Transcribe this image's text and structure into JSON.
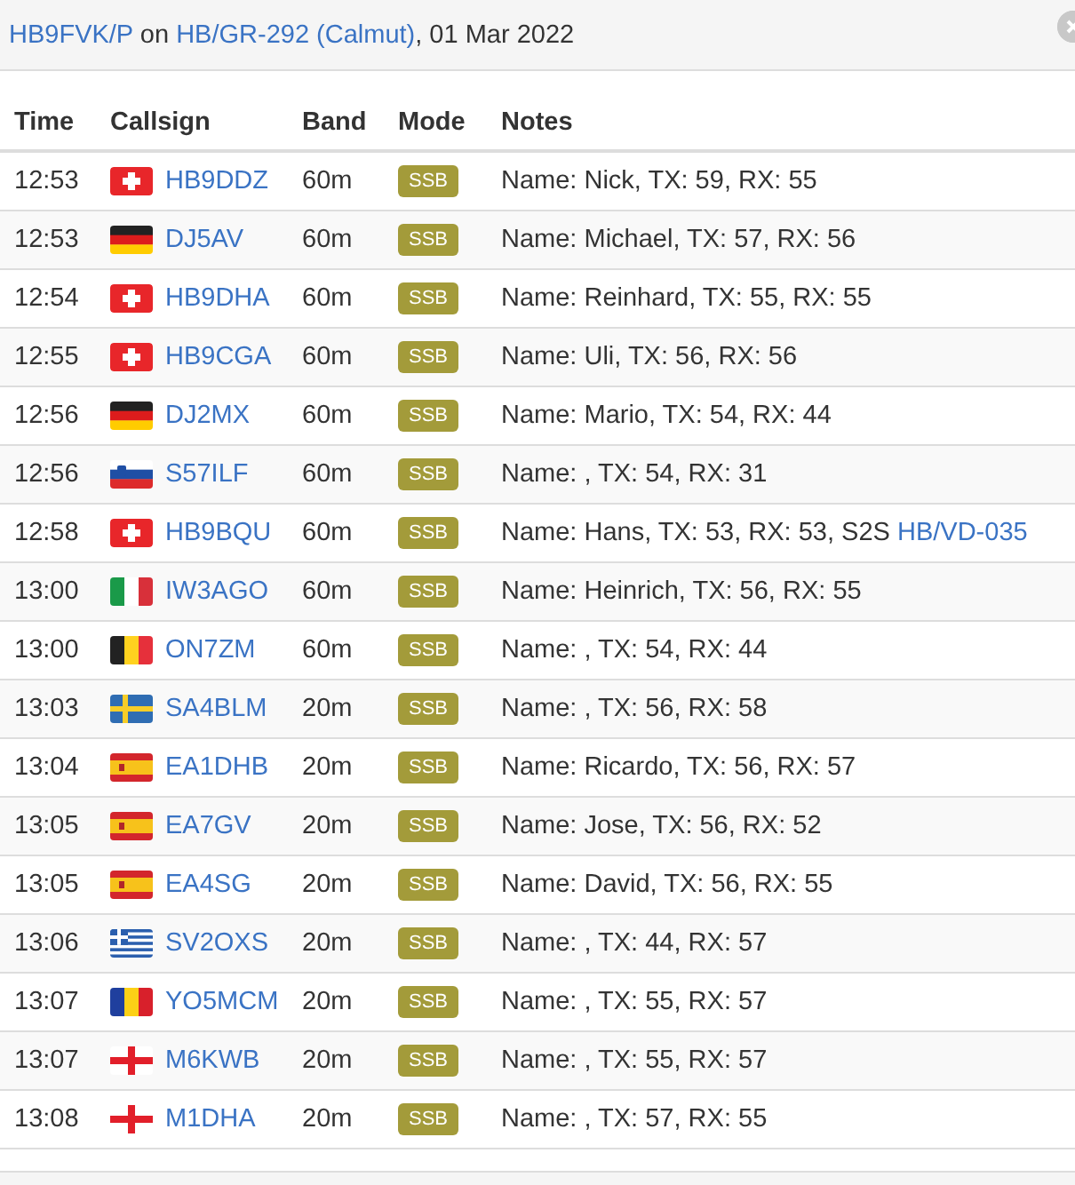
{
  "header": {
    "activator": "HB9FVK/P",
    "on": "on",
    "summit": "HB/GR-292 (Calmut)",
    "date": ", 01 Mar 2022"
  },
  "table": {
    "columns": [
      "Time",
      "Callsign",
      "Band",
      "Mode",
      "Notes"
    ],
    "rows": [
      {
        "time": "12:53",
        "flag": {
          "kind": "ch"
        },
        "callsign": "HB9DDZ",
        "band": "60m",
        "mode": "SSB",
        "notes": "Name: Nick, TX: 59, RX: 55"
      },
      {
        "time": "12:53",
        "flag": {
          "kind": "de"
        },
        "callsign": "DJ5AV",
        "band": "60m",
        "mode": "SSB",
        "notes": "Name: Michael, TX: 57, RX: 56"
      },
      {
        "time": "12:54",
        "flag": {
          "kind": "ch"
        },
        "callsign": "HB9DHA",
        "band": "60m",
        "mode": "SSB",
        "notes": "Name: Reinhard, TX: 55, RX: 55"
      },
      {
        "time": "12:55",
        "flag": {
          "kind": "ch"
        },
        "callsign": "HB9CGA",
        "band": "60m",
        "mode": "SSB",
        "notes": "Name: Uli, TX: 56, RX: 56"
      },
      {
        "time": "12:56",
        "flag": {
          "kind": "de"
        },
        "callsign": "DJ2MX",
        "band": "60m",
        "mode": "SSB",
        "notes": "Name: Mario, TX: 54, RX: 44"
      },
      {
        "time": "12:56",
        "flag": {
          "kind": "si"
        },
        "callsign": "S57ILF",
        "band": "60m",
        "mode": "SSB",
        "notes": "Name: , TX: 54, RX: 31"
      },
      {
        "time": "12:58",
        "flag": {
          "kind": "ch"
        },
        "callsign": "HB9BQU",
        "band": "60m",
        "mode": "SSB",
        "notes": "Name: Hans, TX: 53, RX: 53, S2S ",
        "s2s": "HB/VD-035"
      },
      {
        "time": "13:00",
        "flag": {
          "kind": "it"
        },
        "callsign": "IW3AGO",
        "band": "60m",
        "mode": "SSB",
        "notes": "Name: Heinrich, TX: 56, RX: 55"
      },
      {
        "time": "13:00",
        "flag": {
          "kind": "be"
        },
        "callsign": "ON7ZM",
        "band": "60m",
        "mode": "SSB",
        "notes": "Name: , TX: 54, RX: 44"
      },
      {
        "time": "13:03",
        "flag": {
          "kind": "se"
        },
        "callsign": "SA4BLM",
        "band": "20m",
        "mode": "SSB",
        "notes": "Name: , TX: 56, RX: 58"
      },
      {
        "time": "13:04",
        "flag": {
          "kind": "es"
        },
        "callsign": "EA1DHB",
        "band": "20m",
        "mode": "SSB",
        "notes": "Name: Ricardo, TX: 56, RX: 57"
      },
      {
        "time": "13:05",
        "flag": {
          "kind": "es"
        },
        "callsign": "EA7GV",
        "band": "20m",
        "mode": "SSB",
        "notes": "Name: Jose, TX: 56, RX: 52"
      },
      {
        "time": "13:05",
        "flag": {
          "kind": "es"
        },
        "callsign": "EA4SG",
        "band": "20m",
        "mode": "SSB",
        "notes": "Name: David, TX: 56, RX: 55"
      },
      {
        "time": "13:06",
        "flag": {
          "kind": "gr"
        },
        "callsign": "SV2OXS",
        "band": "20m",
        "mode": "SSB",
        "notes": "Name: , TX: 44, RX: 57"
      },
      {
        "time": "13:07",
        "flag": {
          "kind": "ro"
        },
        "callsign": "YO5MCM",
        "band": "20m",
        "mode": "SSB",
        "notes": "Name: , TX: 55, RX: 57"
      },
      {
        "time": "13:07",
        "flag": {
          "kind": "en"
        },
        "callsign": "M6KWB",
        "band": "20m",
        "mode": "SSB",
        "notes": "Name: , TX: 55, RX: 57"
      },
      {
        "time": "13:08",
        "flag": {
          "kind": "en"
        },
        "callsign": "M1DHA",
        "band": "20m",
        "mode": "SSB",
        "notes": "Name: , TX: 57, RX: 55"
      }
    ]
  }
}
